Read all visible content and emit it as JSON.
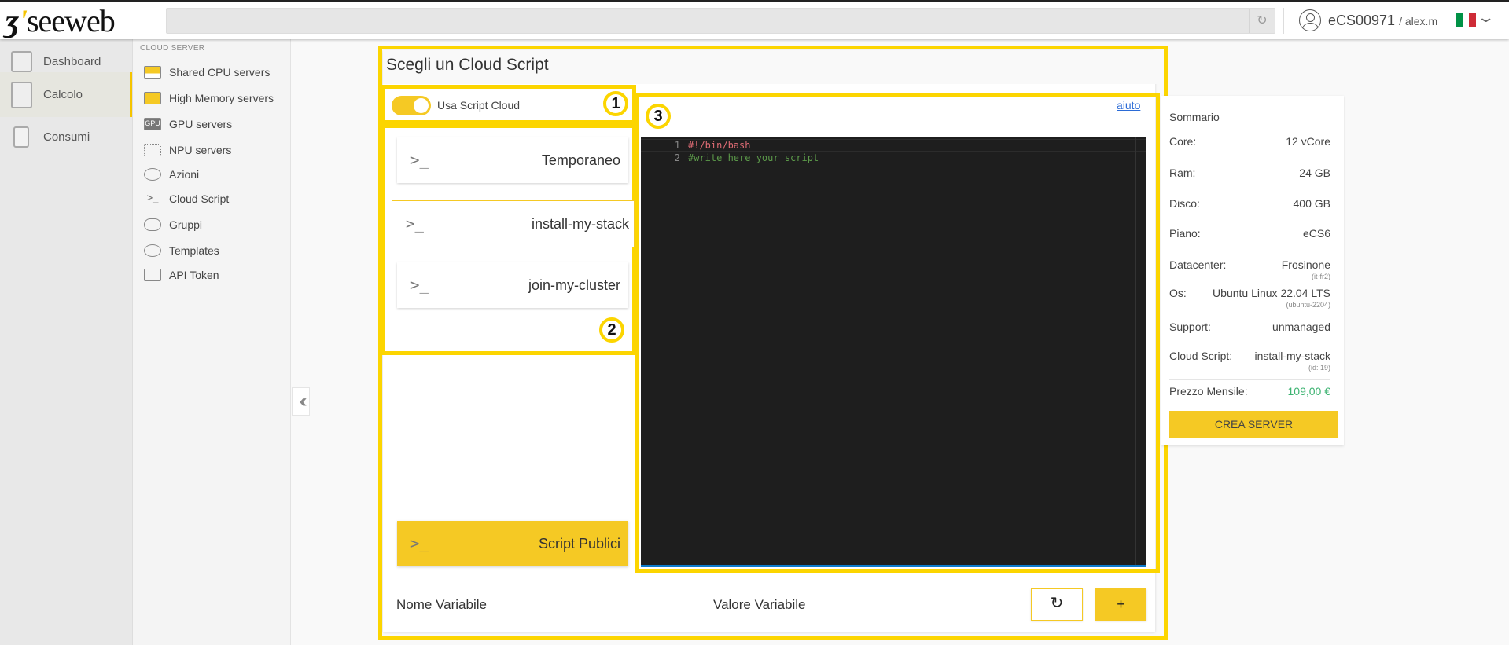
{
  "header": {
    "logo": "seeweb",
    "account_id": "eCS00971",
    "username": "/ alex.m",
    "flag_colors": [
      "#009246",
      "#ffffff",
      "#ce2b37"
    ]
  },
  "sidebar": {
    "items": [
      {
        "label": "Dashboard",
        "icon": "dashboard-icon"
      },
      {
        "label": "Calcolo",
        "icon": "server-icon",
        "active": true
      },
      {
        "label": "Consumi",
        "icon": "document-icon"
      }
    ]
  },
  "subnav": {
    "section": "CLOUD SERVER",
    "items": [
      {
        "label": "Shared CPU servers",
        "icon": "chip-icon"
      },
      {
        "label": "High Memory servers",
        "icon": "memory-icon"
      },
      {
        "label": "GPU servers",
        "icon": "gpu-icon",
        "glyph": "GPU"
      },
      {
        "label": "NPU servers",
        "icon": "npu-icon"
      },
      {
        "label": "Azioni",
        "icon": "actions-icon"
      },
      {
        "label": "Cloud Script",
        "icon": "terminal-icon",
        "glyph": ">_"
      },
      {
        "label": "Gruppi",
        "icon": "group-icon"
      },
      {
        "label": "Templates",
        "icon": "template-icon"
      },
      {
        "label": "API Token",
        "icon": "api-token-icon"
      }
    ]
  },
  "main": {
    "title": "Scegli un Cloud Script",
    "toggle": {
      "label": "Usa Script Cloud",
      "on": true
    },
    "badges": [
      "1",
      "2",
      "3"
    ],
    "scripts": [
      {
        "icon": ">_",
        "name": "Temporaneo"
      },
      {
        "icon": ">_",
        "name": "install-my-stack",
        "selected": true
      },
      {
        "icon": ">_",
        "name": "join-my-cluster"
      }
    ],
    "public_scripts": {
      "icon": ">_",
      "name": "Script Publici"
    },
    "help_link": "aiuto",
    "editor": {
      "lines": [
        {
          "num": "1",
          "code": "#!/bin/bash",
          "color": "#e06c75"
        },
        {
          "num": "2",
          "code": "#write here your script",
          "color": "#5c9a4a"
        }
      ]
    },
    "variables": {
      "name_header": "Nome Variabile",
      "value_header": "Valore Variabile",
      "reset_icon": "↻",
      "add_label": "+"
    }
  },
  "summary": {
    "title": "Sommario",
    "rows": [
      {
        "label": "Core:",
        "value": "12 vCore"
      },
      {
        "label": "Ram:",
        "value": "24 GB"
      },
      {
        "label": "Disco:",
        "value": "400 GB"
      },
      {
        "label": "Piano:",
        "value": "eCS6"
      },
      {
        "label": "Datacenter:",
        "value": "Frosinone",
        "sub": "(it-fr2)"
      },
      {
        "label": "Os:",
        "value": "Ubuntu Linux 22.04 LTS",
        "sub": "(ubuntu-2204)"
      },
      {
        "label": "Support:",
        "value": "unmanaged"
      },
      {
        "label": "Cloud Script:",
        "value": "install-my-stack",
        "sub": "(id: 19)"
      }
    ],
    "price_label": "Prezzo Mensile:",
    "price_value": "109,00 €",
    "price_color": "#3cb371",
    "create_button": "CREA SERVER"
  },
  "colors": {
    "accent": "#f5c924",
    "highlight_border": "#fcd500",
    "link": "#2b6bd6"
  }
}
